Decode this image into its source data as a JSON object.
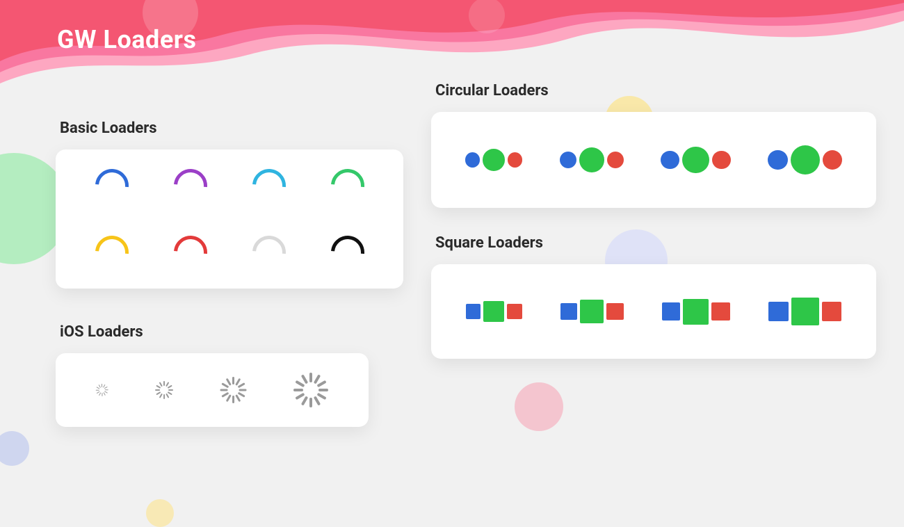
{
  "title": "GW Loaders",
  "sections": {
    "basic": {
      "title": "Basic Loaders"
    },
    "ios": {
      "title": "iOS Loaders"
    },
    "circular": {
      "title": "Circular Loaders"
    },
    "square": {
      "title": "Square Loaders"
    }
  },
  "colors": {
    "basic": [
      "#2f6bd8",
      "#9b3fc7",
      "#2fb4e0",
      "#34c86a",
      "#f7c419",
      "#e33a3a",
      "#d9d9d9",
      "#111111"
    ],
    "triad": {
      "blue": "#2f6bd8",
      "green": "#2ec648",
      "red": "#e44a3d"
    },
    "header": "#f45672",
    "headerLight": "#f977a0"
  },
  "ios_sizes": [
    18,
    26,
    38,
    50
  ],
  "shape_scales": [
    0.5,
    0.7,
    0.85,
    1.0
  ],
  "shape_base_sizes": {
    "side": 24,
    "mid": 34,
    "max_circle": 42,
    "max_square": 40
  }
}
